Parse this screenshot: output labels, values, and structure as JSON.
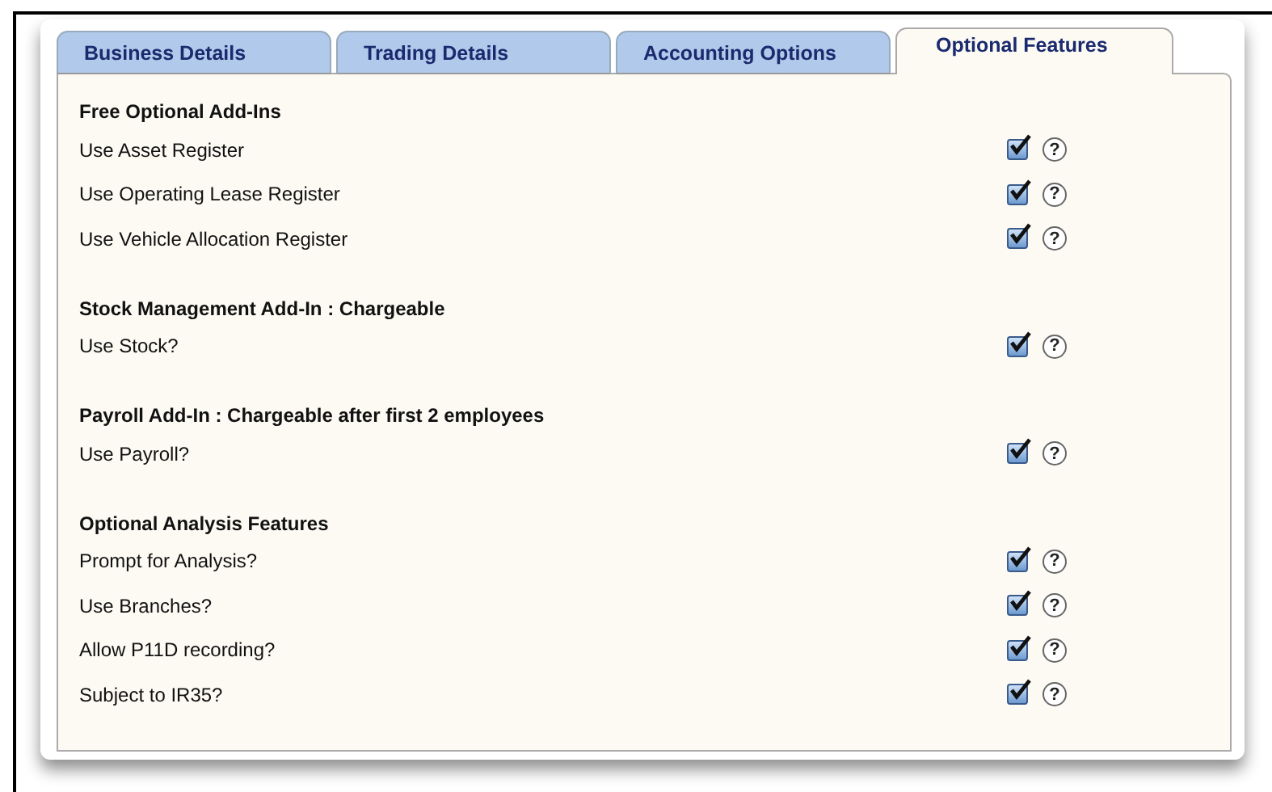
{
  "tabs": [
    {
      "label": "Business Details",
      "selected": false
    },
    {
      "label": "Trading Details",
      "selected": false
    },
    {
      "label": "Accounting Options",
      "selected": false
    },
    {
      "label": "Optional Features",
      "selected": true
    }
  ],
  "sections": [
    {
      "heading": "Free Optional Add-Ins",
      "options": [
        {
          "label": "Use Asset Register",
          "checked": true,
          "help": "?"
        },
        {
          "label": "Use Operating Lease Register",
          "checked": true,
          "help": "?"
        },
        {
          "label": "Use Vehicle Allocation Register",
          "checked": true,
          "help": "?"
        }
      ]
    },
    {
      "heading": "Stock Management Add-In : Chargeable",
      "options": [
        {
          "label": "Use Stock?",
          "checked": true,
          "help": "?"
        }
      ]
    },
    {
      "heading": "Payroll Add-In : Chargeable after first 2 employees",
      "options": [
        {
          "label": "Use Payroll?",
          "checked": true,
          "help": "?"
        }
      ]
    },
    {
      "heading": "Optional Analysis Features",
      "options": [
        {
          "label": "Prompt for Analysis?",
          "checked": true,
          "help": "?"
        },
        {
          "label": "Use Branches?",
          "checked": true,
          "help": "?"
        },
        {
          "label": "Allow P11D recording?",
          "checked": true,
          "help": "?"
        },
        {
          "label": "Subject to IR35?",
          "checked": true,
          "help": "?"
        }
      ]
    }
  ]
}
